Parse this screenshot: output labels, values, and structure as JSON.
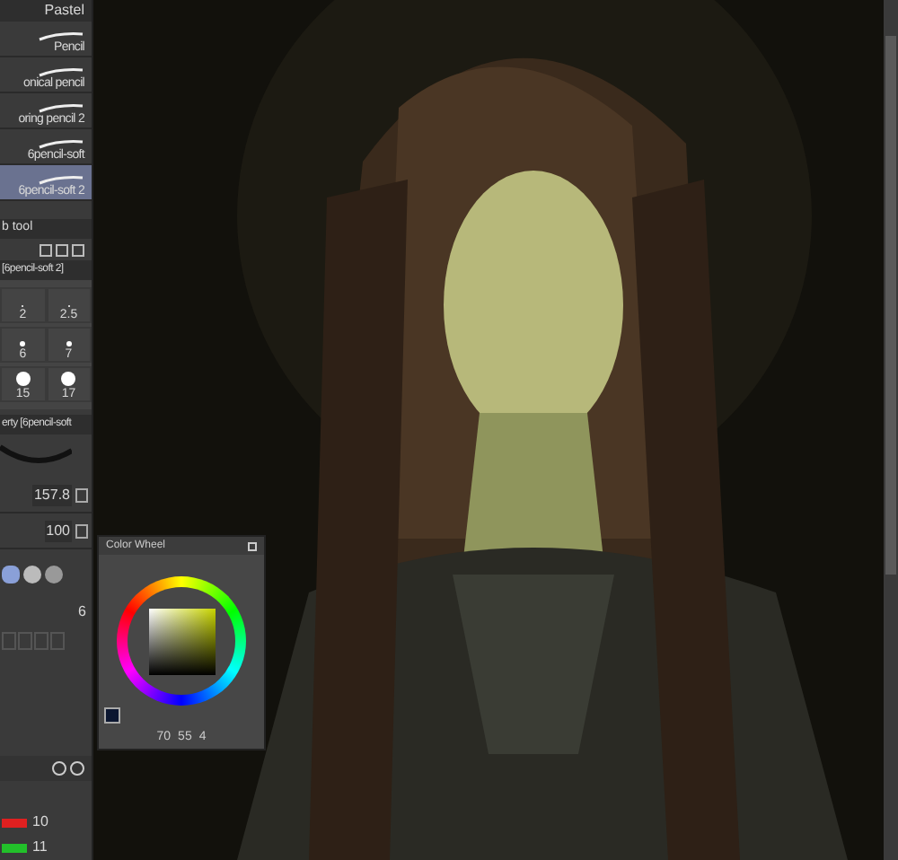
{
  "brush_group": {
    "label": "Pastel"
  },
  "brushes": [
    {
      "label": "Pencil",
      "selected": false
    },
    {
      "label": "onical pencil",
      "selected": false
    },
    {
      "label": "oring pencil 2",
      "selected": false
    },
    {
      "label": "6pencil-soft",
      "selected": false
    },
    {
      "label": "6pencil-soft 2",
      "selected": true
    }
  ],
  "tool_palette": {
    "title": "b tool",
    "sub_tool": "[6pencil-soft 2]"
  },
  "brush_sizes": [
    "2",
    "2.5",
    "6",
    "7",
    "15",
    "17"
  ],
  "property": {
    "title": "erty [6pencil-soft",
    "size": "157.8",
    "opacity": "100",
    "density": "6"
  },
  "color_wheel": {
    "title": "Color Wheel",
    "values": [
      "70",
      "55",
      "4"
    ]
  },
  "color_sliders": [
    {
      "value": "10",
      "color": "#e02020"
    },
    {
      "value": "11",
      "color": "#22c02a"
    }
  ]
}
